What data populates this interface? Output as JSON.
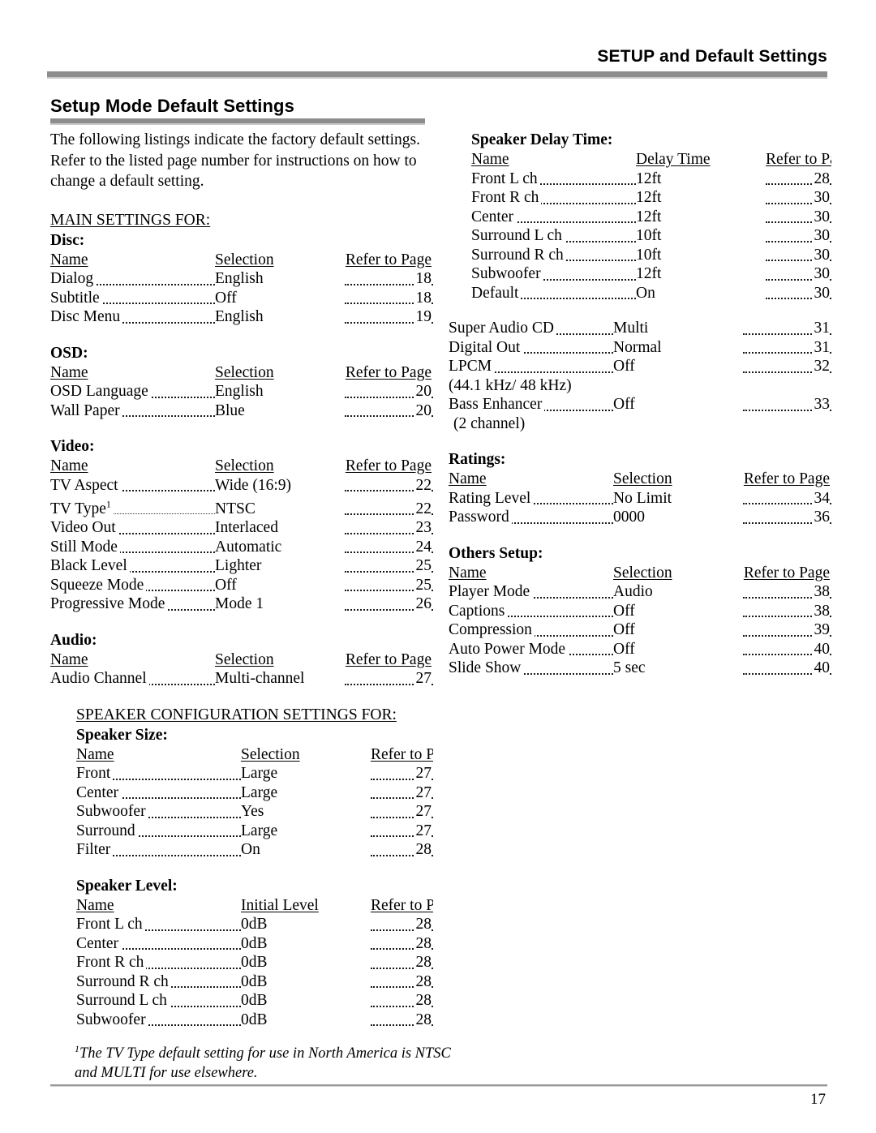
{
  "header": {
    "running_title": "SETUP and Default Settings",
    "page_title": "Setup Mode Default Settings"
  },
  "intro": "The following listings indicate the factory default settings. Refer to the listed page number for instructions on how to change a default setting.",
  "left_column": {
    "main_settings_head": "MAIN SETTINGS FOR:",
    "disc": {
      "title": "Disc:",
      "columns": [
        "Name",
        "Selection",
        "Refer to Page"
      ],
      "rows": [
        {
          "name": "Dialog",
          "selection": "English",
          "page": "18"
        },
        {
          "name": "Subtitle",
          "selection": "Off",
          "page": "18"
        },
        {
          "name": "Disc Menu",
          "selection": "English",
          "page": "19"
        }
      ]
    },
    "osd": {
      "title": "OSD:",
      "columns": [
        "Name",
        "Selection",
        "Refer to Page"
      ],
      "rows": [
        {
          "name": "OSD Language",
          "selection": "English",
          "page": "20"
        },
        {
          "name": "Wall Paper",
          "selection": "Blue",
          "page": "20"
        }
      ]
    },
    "video": {
      "title": "Video:",
      "columns": [
        "Name",
        "Selection",
        "Refer to Page"
      ],
      "rows": [
        {
          "name": "TV Aspect",
          "selection": "Wide (16:9)",
          "page": "22"
        },
        {
          "name": "TV Type",
          "footnote_marker": "1",
          "selection": "NTSC",
          "page": "22"
        },
        {
          "name": "Video Out",
          "selection": "Interlaced",
          "page": "23"
        },
        {
          "name": "Still Mode",
          "selection": "Automatic",
          "page": "24"
        },
        {
          "name": "Black Level",
          "selection": "Lighter",
          "page": "25"
        },
        {
          "name": "Squeeze Mode",
          "selection": "Off",
          "page": "25"
        },
        {
          "name": "Progressive Mode",
          "selection": "Mode 1",
          "page": "26"
        }
      ]
    },
    "audio": {
      "title": "Audio:",
      "columns": [
        "Name",
        "Selection",
        "Refer to Page"
      ],
      "rows": [
        {
          "name": "Audio Channel",
          "selection": "Multi-channel",
          "page": "27"
        }
      ]
    },
    "speaker_config_head": "SPEAKER CONFIGURATION SETTINGS FOR:",
    "speaker_size": {
      "title": "Speaker Size:",
      "columns": [
        "Name",
        "Selection",
        "Refer to Page"
      ],
      "rows": [
        {
          "name": "Front",
          "selection": "Large",
          "page": "27"
        },
        {
          "name": "Center",
          "selection": "Large",
          "page": "27"
        },
        {
          "name": "Subwoofer",
          "selection": "Yes",
          "page": "27"
        },
        {
          "name": "Surround",
          "selection": "Large",
          "page": "27"
        },
        {
          "name": "Filter",
          "selection": "On",
          "page": "28"
        }
      ]
    },
    "speaker_level": {
      "title": "Speaker Level:",
      "columns": [
        "Name",
        "Initial Level",
        "Refer to Page"
      ],
      "rows": [
        {
          "name": "Front L ch",
          "selection": "0dB",
          "page": "28"
        },
        {
          "name": "Center",
          "selection": "0dB",
          "page": "28"
        },
        {
          "name": "Front R ch",
          "selection": "0dB",
          "page": "28"
        },
        {
          "name": "Surround R ch",
          "selection": "0dB",
          "page": "28"
        },
        {
          "name": "Surround L ch",
          "selection": "0dB",
          "page": "28"
        },
        {
          "name": "Subwoofer",
          "selection": "0dB",
          "page": "28"
        }
      ]
    }
  },
  "right_column": {
    "speaker_delay": {
      "title": "Speaker Delay Time:",
      "columns": [
        "Name",
        "Delay Time",
        "Refer to Page"
      ],
      "rows": [
        {
          "name": "Front L ch",
          "selection": "12ft",
          "page": "28"
        },
        {
          "name": "Front R ch",
          "selection": "12ft",
          "page": "30"
        },
        {
          "name": "Center",
          "selection": "12ft",
          "page": "30"
        },
        {
          "name": "Surround L ch",
          "selection": "10ft",
          "page": "30"
        },
        {
          "name": "Surround R ch",
          "selection": "10ft",
          "page": "30"
        },
        {
          "name": "Subwoofer",
          "selection": "12ft",
          "page": "30"
        },
        {
          "name": "Default",
          "selection": "On",
          "page": "30"
        }
      ]
    },
    "audio_extra": {
      "rows": [
        {
          "name": "Super Audio CD",
          "selection": "Multi",
          "page": "31"
        },
        {
          "name": "Digital Out",
          "selection": "Normal",
          "page": "31"
        },
        {
          "name": "LPCM",
          "selection": "Off",
          "page": "32"
        }
      ],
      "note_lpcm": "(44.1 kHz/ 48 kHz)",
      "rows2": [
        {
          "name": "Bass Enhancer",
          "selection": "Off",
          "page": "33"
        }
      ],
      "note_bass": "(2 channel)"
    },
    "ratings": {
      "title": "Ratings:",
      "columns": [
        "Name",
        "Selection",
        "Refer to Page"
      ],
      "rows": [
        {
          "name": "Rating Level",
          "selection": "No Limit",
          "page": "34"
        },
        {
          "name": "Password",
          "selection": "0000",
          "page": "36"
        }
      ]
    },
    "others_setup": {
      "title": "Others Setup:",
      "columns": [
        "Name",
        "Selection",
        "Refer to Page"
      ],
      "rows": [
        {
          "name": "Player Mode",
          "selection": "Audio",
          "page": "38"
        },
        {
          "name": "Captions",
          "selection": "Off",
          "page": "38"
        },
        {
          "name": "Compression",
          "selection": "Off",
          "page": "39"
        },
        {
          "name": "Auto Power Mode",
          "selection": "Off",
          "page": "40"
        },
        {
          "name": "Slide Show",
          "selection": "5 sec",
          "page": "40"
        }
      ]
    }
  },
  "footnote": {
    "marker": "1",
    "text": "The TV Type default setting for use in North America is NTSC and MULTI for use elsewhere."
  },
  "page_number": "17",
  "colors": {
    "rule_gray": "#8d8d8d",
    "rule_light": "#c9c9c9",
    "text": "#000000"
  }
}
